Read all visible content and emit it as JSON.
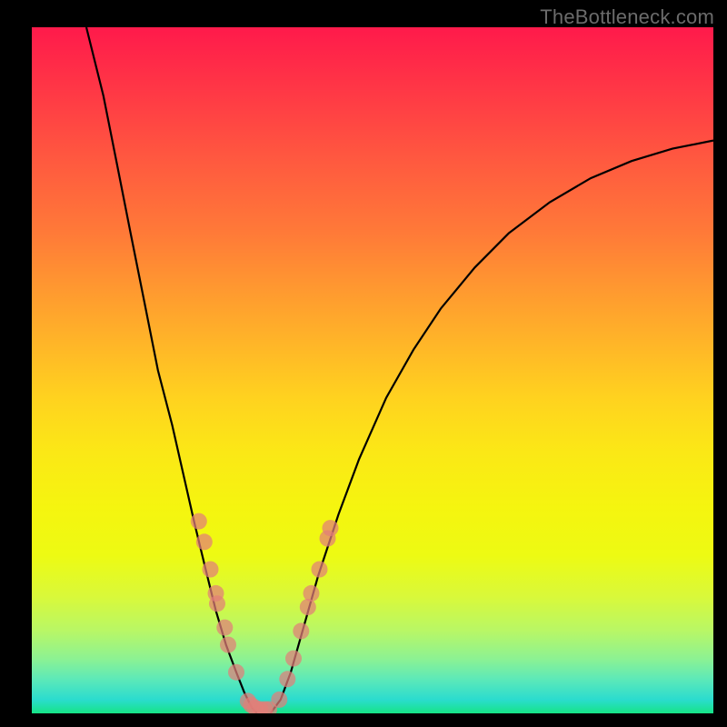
{
  "watermark": "TheBottleneck.com",
  "colors": {
    "background": "#000000",
    "gradient_top": "#ff1a4b",
    "gradient_bottom": "#16e486",
    "curve": "#000000",
    "datapoint": "#e27e78"
  },
  "chart_data": {
    "type": "line",
    "title": "",
    "xlabel": "",
    "ylabel": "",
    "xlim": [
      0,
      100
    ],
    "ylim": [
      0,
      100
    ],
    "curve": {
      "left": [
        {
          "x": 8.0,
          "y": 100.0
        },
        {
          "x": 10.5,
          "y": 90.0
        },
        {
          "x": 12.5,
          "y": 80.0
        },
        {
          "x": 14.5,
          "y": 70.0
        },
        {
          "x": 16.5,
          "y": 60.0
        },
        {
          "x": 18.5,
          "y": 50.0
        },
        {
          "x": 20.6,
          "y": 42.0
        },
        {
          "x": 22.2,
          "y": 35.0
        },
        {
          "x": 23.8,
          "y": 28.0
        },
        {
          "x": 25.5,
          "y": 21.0
        },
        {
          "x": 27.0,
          "y": 15.0
        },
        {
          "x": 28.5,
          "y": 10.0
        },
        {
          "x": 30.0,
          "y": 6.0
        },
        {
          "x": 31.2,
          "y": 3.0
        },
        {
          "x": 32.2,
          "y": 1.0
        },
        {
          "x": 33.0,
          "y": 0.0
        }
      ],
      "right": [
        {
          "x": 35.0,
          "y": 0.0
        },
        {
          "x": 36.5,
          "y": 2.0
        },
        {
          "x": 38.0,
          "y": 6.0
        },
        {
          "x": 40.0,
          "y": 13.0
        },
        {
          "x": 42.0,
          "y": 20.0
        },
        {
          "x": 45.0,
          "y": 29.0
        },
        {
          "x": 48.0,
          "y": 37.0
        },
        {
          "x": 52.0,
          "y": 46.0
        },
        {
          "x": 56.0,
          "y": 53.0
        },
        {
          "x": 60.0,
          "y": 59.0
        },
        {
          "x": 65.0,
          "y": 65.0
        },
        {
          "x": 70.0,
          "y": 70.0
        },
        {
          "x": 76.0,
          "y": 74.5
        },
        {
          "x": 82.0,
          "y": 78.0
        },
        {
          "x": 88.0,
          "y": 80.5
        },
        {
          "x": 94.0,
          "y": 82.3
        },
        {
          "x": 100.0,
          "y": 83.5
        }
      ]
    },
    "series": [
      {
        "name": "points",
        "points": [
          {
            "x": 24.5,
            "y": 28.0
          },
          {
            "x": 25.3,
            "y": 25.0
          },
          {
            "x": 26.2,
            "y": 21.0
          },
          {
            "x": 27.0,
            "y": 17.5
          },
          {
            "x": 27.2,
            "y": 16.0
          },
          {
            "x": 28.3,
            "y": 12.5
          },
          {
            "x": 28.8,
            "y": 10.0
          },
          {
            "x": 30.0,
            "y": 6.0
          },
          {
            "x": 31.7,
            "y": 1.8
          },
          {
            "x": 32.2,
            "y": 1.2
          },
          {
            "x": 32.8,
            "y": 0.8
          },
          {
            "x": 33.5,
            "y": 0.6
          },
          {
            "x": 34.2,
            "y": 0.6
          },
          {
            "x": 34.8,
            "y": 0.6
          },
          {
            "x": 36.3,
            "y": 2.0
          },
          {
            "x": 37.5,
            "y": 5.0
          },
          {
            "x": 38.4,
            "y": 8.0
          },
          {
            "x": 39.5,
            "y": 12.0
          },
          {
            "x": 40.5,
            "y": 15.5
          },
          {
            "x": 41.0,
            "y": 17.5
          },
          {
            "x": 42.2,
            "y": 21.0
          },
          {
            "x": 43.4,
            "y": 25.5
          },
          {
            "x": 43.8,
            "y": 27.0
          }
        ]
      }
    ]
  }
}
